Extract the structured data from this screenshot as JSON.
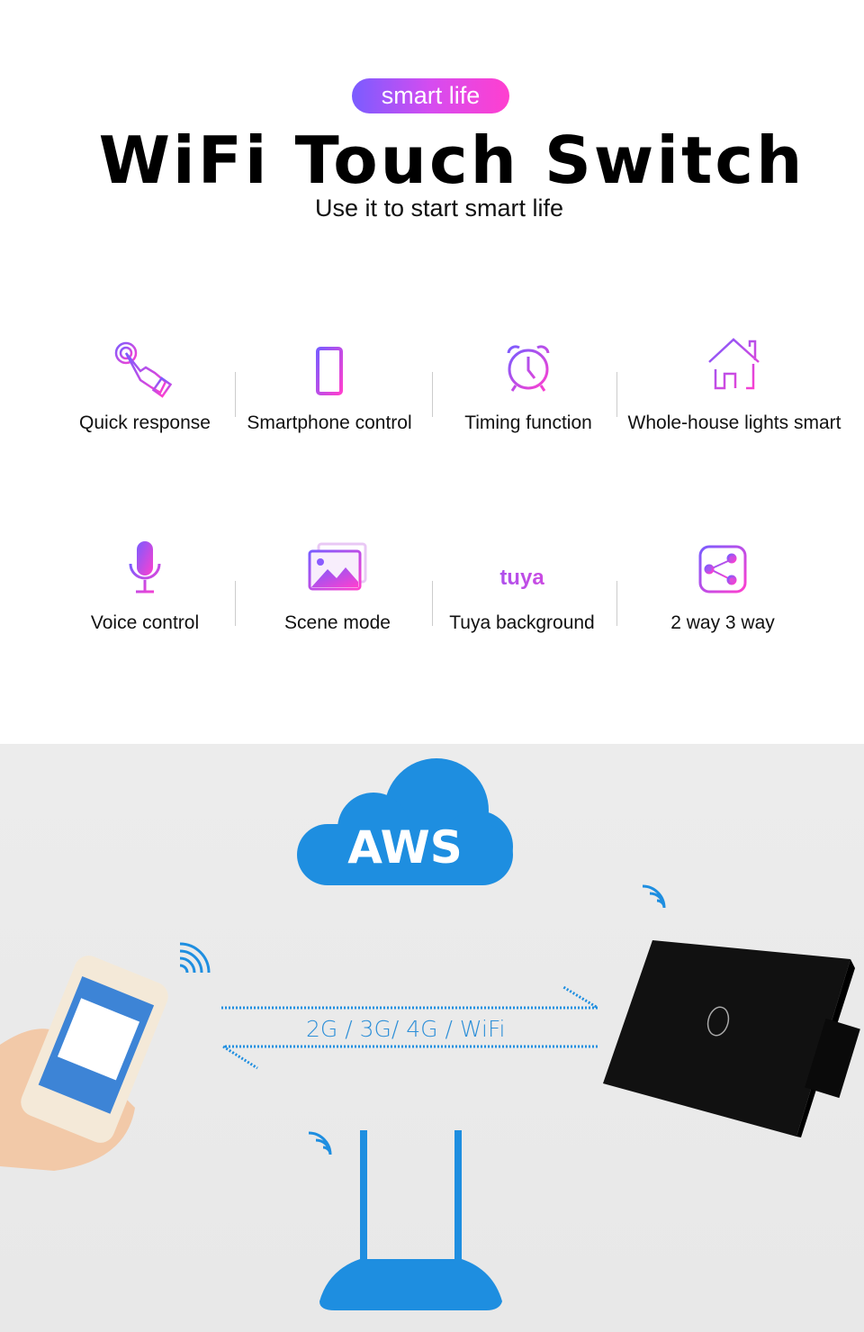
{
  "header": {
    "badge": "smart life",
    "title": "WiFi Touch Switch",
    "subtitle": "Use it to start smart life"
  },
  "features": [
    {
      "label": "Quick response",
      "icon": "touch-hand-icon"
    },
    {
      "label": "Smartphone control",
      "icon": "smartphone-icon"
    },
    {
      "label": "Timing function",
      "icon": "alarm-clock-icon"
    },
    {
      "label": "Whole-house lights smart",
      "icon": "house-icon"
    },
    {
      "label": "Voice control",
      "icon": "microphone-icon"
    },
    {
      "label": "Scene mode",
      "icon": "image-icon"
    },
    {
      "label": "Tuya background",
      "icon": "tuya-logo"
    },
    {
      "label": "2 way 3 way",
      "icon": "share-icon"
    }
  ],
  "tuya_logo": "tuya",
  "diagram": {
    "cloud_label": "AWS",
    "protocol_label": "2G / 3G/ 4G / WiFi"
  },
  "colors": {
    "gradient_start": "#7a5cff",
    "gradient_end": "#ff3fcf",
    "blue": "#1e8ee0",
    "background": "#ebebeb"
  }
}
